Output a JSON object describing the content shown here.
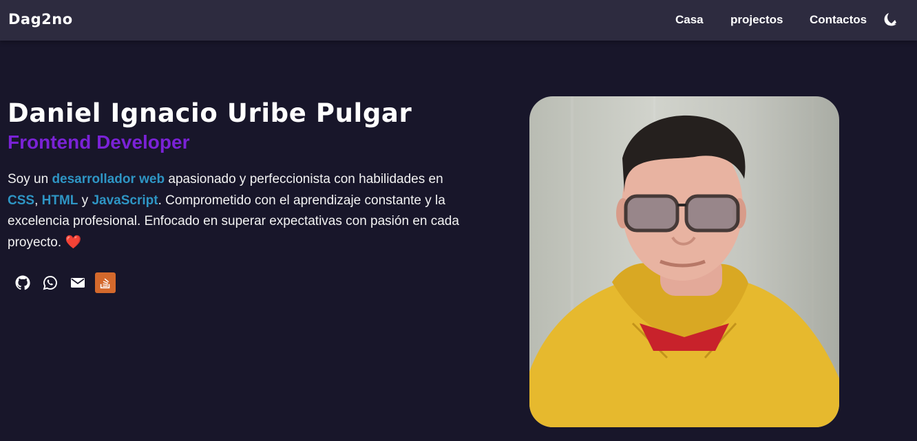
{
  "navbar": {
    "brand": "Dag2no",
    "links": [
      "Casa",
      "projectos",
      "Contactos"
    ],
    "theme_icon": "moon-icon"
  },
  "hero": {
    "name": "Daniel Ignacio Uribe Pulgar",
    "role": "Frontend Developer",
    "bio": {
      "p1": "Soy un ",
      "h1": "desarrollador web",
      "p2": " apasionado y perfeccionista con habilidades en ",
      "h2": "CSS",
      "p3": ", ",
      "h3": "HTML",
      "p4": " y ",
      "h4": "JavaScript",
      "p5": ". Comprometido con el aprendizaje constante y la excelencia profesional. Enfocado en superar expectativas con pasión en cada proyecto. ",
      "heart": "❤️"
    },
    "socials": [
      "github-icon",
      "whatsapp-icon",
      "mail-icon",
      "stackoverflow-icon"
    ]
  },
  "colors": {
    "background": "#18162a",
    "navbar": "#2d2b3f",
    "accent_purple": "#7a22d6",
    "highlight_blue": "#2e95c4",
    "stackoverflow_orange": "#d4692c"
  }
}
